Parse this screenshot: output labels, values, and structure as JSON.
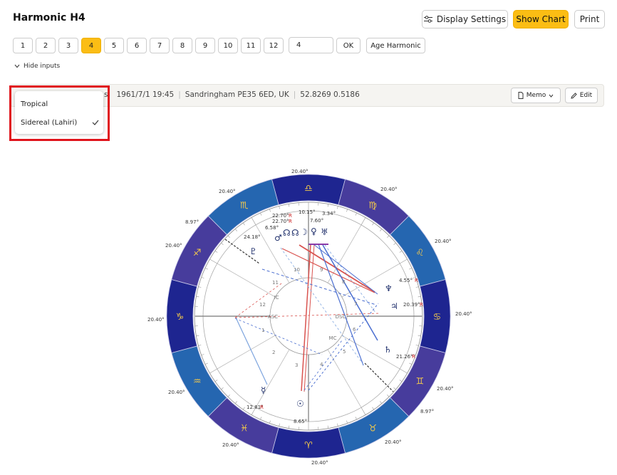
{
  "header": {
    "title": "Harmonic H4",
    "display_settings": "Display Settings",
    "show_chart": "Show Chart",
    "print": "Print"
  },
  "harmonics": {
    "buttons": [
      "1",
      "2",
      "3",
      "4",
      "5",
      "6",
      "7",
      "8",
      "9",
      "10",
      "11",
      "12"
    ],
    "active": "4",
    "input_value": "4",
    "ok": "OK",
    "age_harmonic": "Age Harmonic"
  },
  "hide_inputs": "Hide inputs",
  "info_bar": {
    "partial": "s",
    "datetime": "1961/7/1 19:45",
    "place": "Sandringham PE35 6ED, UK",
    "coords": "52.8269 0.5186",
    "memo": "Memo",
    "edit": "Edit"
  },
  "zodiac_dropdown": {
    "options": [
      "Tropical",
      "Sidereal (Lahiri)"
    ],
    "selected": "Sidereal (Lahiri)"
  },
  "chart": {
    "cusp_degrees": {
      "top": "20.40°",
      "top_right": "20.40°",
      "right_upper": "20.40°",
      "right": "20.40°",
      "right_lower": "20.40°",
      "bottom_right_a": "8.97°",
      "bottom_right_b": "20.40°",
      "bottom": "20.40°",
      "bottom_left": "20.40°",
      "left_lower": "20.40°",
      "left": "20.40°",
      "left_upper": "20.40°",
      "top_left_a": "8.97°",
      "top_left_b": "20.40°"
    },
    "planet_labels": {
      "p1": "22.70°",
      "p2": "22.70°",
      "p3": "10.15°",
      "p4": "7.60°",
      "p5": "3.34°",
      "p6": "6.58°",
      "p7": "24.18°",
      "p8": "4.55°",
      "p9": "20.39°",
      "p10": "21.26°",
      "p11": "12.81°",
      "p12": "8.65°"
    },
    "retro": "R",
    "angles": {
      "ic": "IC",
      "asc": "ASC",
      "dsc": "DSC",
      "mc": "MC"
    },
    "house_numbers": [
      "1",
      "2",
      "3",
      "4",
      "5",
      "6",
      "7",
      "8",
      "9",
      "10",
      "11",
      "12"
    ],
    "colors": {
      "ring_dark": "#1e2590",
      "ring_mid": "#2566b0",
      "ring_purple": "#473c9c",
      "accent": "#fbbd14"
    }
  }
}
